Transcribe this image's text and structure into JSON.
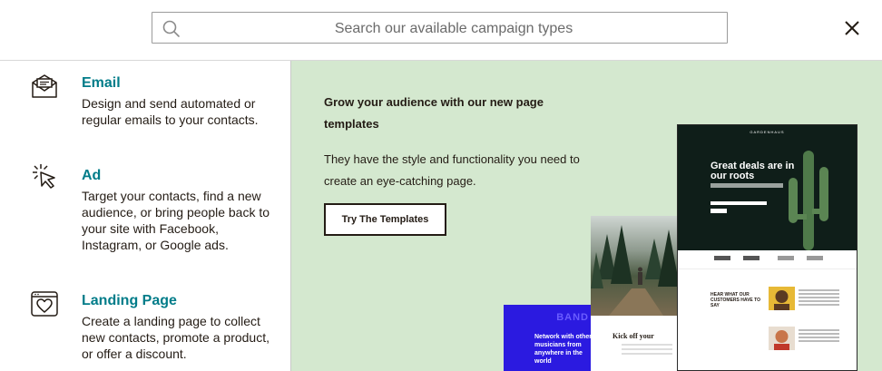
{
  "search": {
    "placeholder": "Search our available campaign types"
  },
  "menu": {
    "items": [
      {
        "icon": "envelope-icon",
        "title": "Email",
        "description": "Design and send automated or regular emails to your contacts."
      },
      {
        "icon": "cursor-click-icon",
        "title": "Ad",
        "description": "Target your contacts, find a new audience, or bring people back to your site with Facebook, Instagram, or Google ads."
      },
      {
        "icon": "heart-page-icon",
        "title": "Landing Page",
        "description": "Create a landing page to collect new contacts, promote a product, or offer a discount."
      }
    ]
  },
  "promo": {
    "heading": "Grow your audience with our new page templates",
    "body": "They have the style and functionality you need to create an eye-catching page.",
    "button_label": "Try The Templates",
    "background": "#d4e8cf",
    "previews": {
      "band": {
        "logo": "BAND",
        "text": "Network with other musicians from anywhere in the world"
      },
      "hike": {
        "title": "Kick off your"
      },
      "garden": {
        "brand": "GARDENHAUS",
        "headline": "Great deals are in our roots",
        "testimonial_heading": "HEAR WHAT OUR CUSTOMERS HAVE TO SAY"
      }
    }
  },
  "colors": {
    "accent": "#007c89",
    "text": "#241c15"
  }
}
